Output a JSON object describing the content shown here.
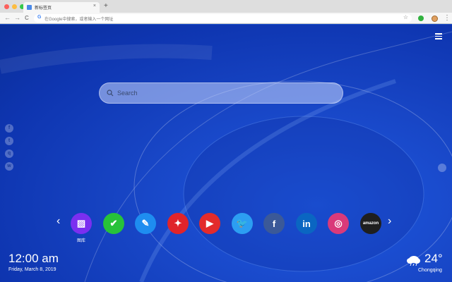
{
  "browser": {
    "tab_title": "新标签页",
    "tab_close": "×",
    "new_tab": "+",
    "back": "←",
    "forward": "→",
    "reload": "C",
    "omnibox_placeholder": "在Google中搜索，或者输入一个网址",
    "search_engine_glyph": "G",
    "bookmark": "☆",
    "menu": "⋮"
  },
  "page": {
    "search_placeholder": "Search",
    "social_icons": [
      "facebook-icon",
      "twitter-icon",
      "qq-icon",
      "wechat-icon"
    ],
    "apps": [
      {
        "name": "gallery",
        "label": "图库",
        "color": "#7b2ff0",
        "glyph": "▨"
      },
      {
        "name": "tasks",
        "label": "",
        "color": "#27c23a",
        "glyph": "✔"
      },
      {
        "name": "notes",
        "label": "",
        "color": "#1e8df0",
        "glyph": "✎"
      },
      {
        "name": "games",
        "label": "",
        "color": "#e0242a",
        "glyph": "✦"
      },
      {
        "name": "youtube",
        "label": "",
        "color": "#e32b2b",
        "glyph": "▶"
      },
      {
        "name": "twitter",
        "label": "",
        "color": "#2c9ef2",
        "glyph": "🐦"
      },
      {
        "name": "facebook",
        "label": "",
        "color": "#3b5998",
        "glyph": "f"
      },
      {
        "name": "linkedin",
        "label": "",
        "color": "#0a66c2",
        "glyph": "in"
      },
      {
        "name": "instagram",
        "label": "",
        "color": "#d93a7a",
        "glyph": "◎"
      },
      {
        "name": "amazon",
        "label": "",
        "color": "#1f1f1f",
        "glyph": "amazon"
      }
    ],
    "prev_arrow": "‹",
    "next_arrow": "›",
    "clock": "12:00 am",
    "date": "Friday, March 8, 2019",
    "temperature": "24°",
    "city": "Chongqing"
  }
}
